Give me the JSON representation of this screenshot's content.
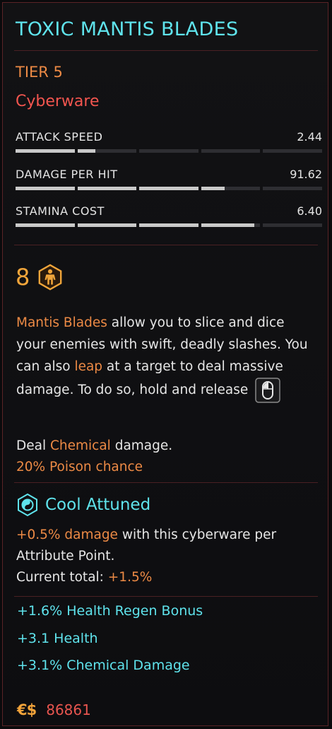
{
  "item": {
    "name": "TOXIC MANTIS BLADES",
    "tier": "TIER 5",
    "category": "Cyberware"
  },
  "stats": [
    {
      "label": "ATTACK SPEED",
      "value": "2.44",
      "fill_segments": 1.3
    },
    {
      "label": "DAMAGE PER HIT",
      "value": "91.62",
      "fill_segments": 3.4
    },
    {
      "label": "STAMINA COST",
      "value": "6.40",
      "fill_segments": 3.9
    }
  ],
  "capacity_cost": {
    "value": "8",
    "icon": "body-silhouette-hex-icon"
  },
  "description": {
    "p1": "Mantis Blades",
    "p2": " allow you to slice and dice your enemies with swift, deadly slashes. You can also ",
    "p3": "leap",
    "p4": " at a target to deal massive damage. To do so, hold and release",
    "mouse_icon": "mouse-button-icon",
    "deal_prefix": "Deal ",
    "deal_type": "Chemical",
    "deal_suffix": " damage.",
    "poison": "20% Poison chance"
  },
  "attunement": {
    "icon": "cool-attribute-icon",
    "label": "Cool Attuned",
    "bonus_value": "+0.5% damage",
    "bonus_text": " with this cyberware per",
    "line2": "Attribute Point.",
    "total_label": "Current total:",
    "total_value": "+1.5%"
  },
  "bonuses": [
    "+1.6% Health Regen Bonus",
    "+3.1 Health",
    "+3.1% Chemical Damage"
  ],
  "price": {
    "currency_icon": "€$",
    "value": "86861"
  },
  "colors": {
    "title": "#5fe3ec",
    "tier": "#ec8a45",
    "category": "#f2554f",
    "highlight": "#ec8a45",
    "price": "#e8554f",
    "border": "#5a2326"
  }
}
